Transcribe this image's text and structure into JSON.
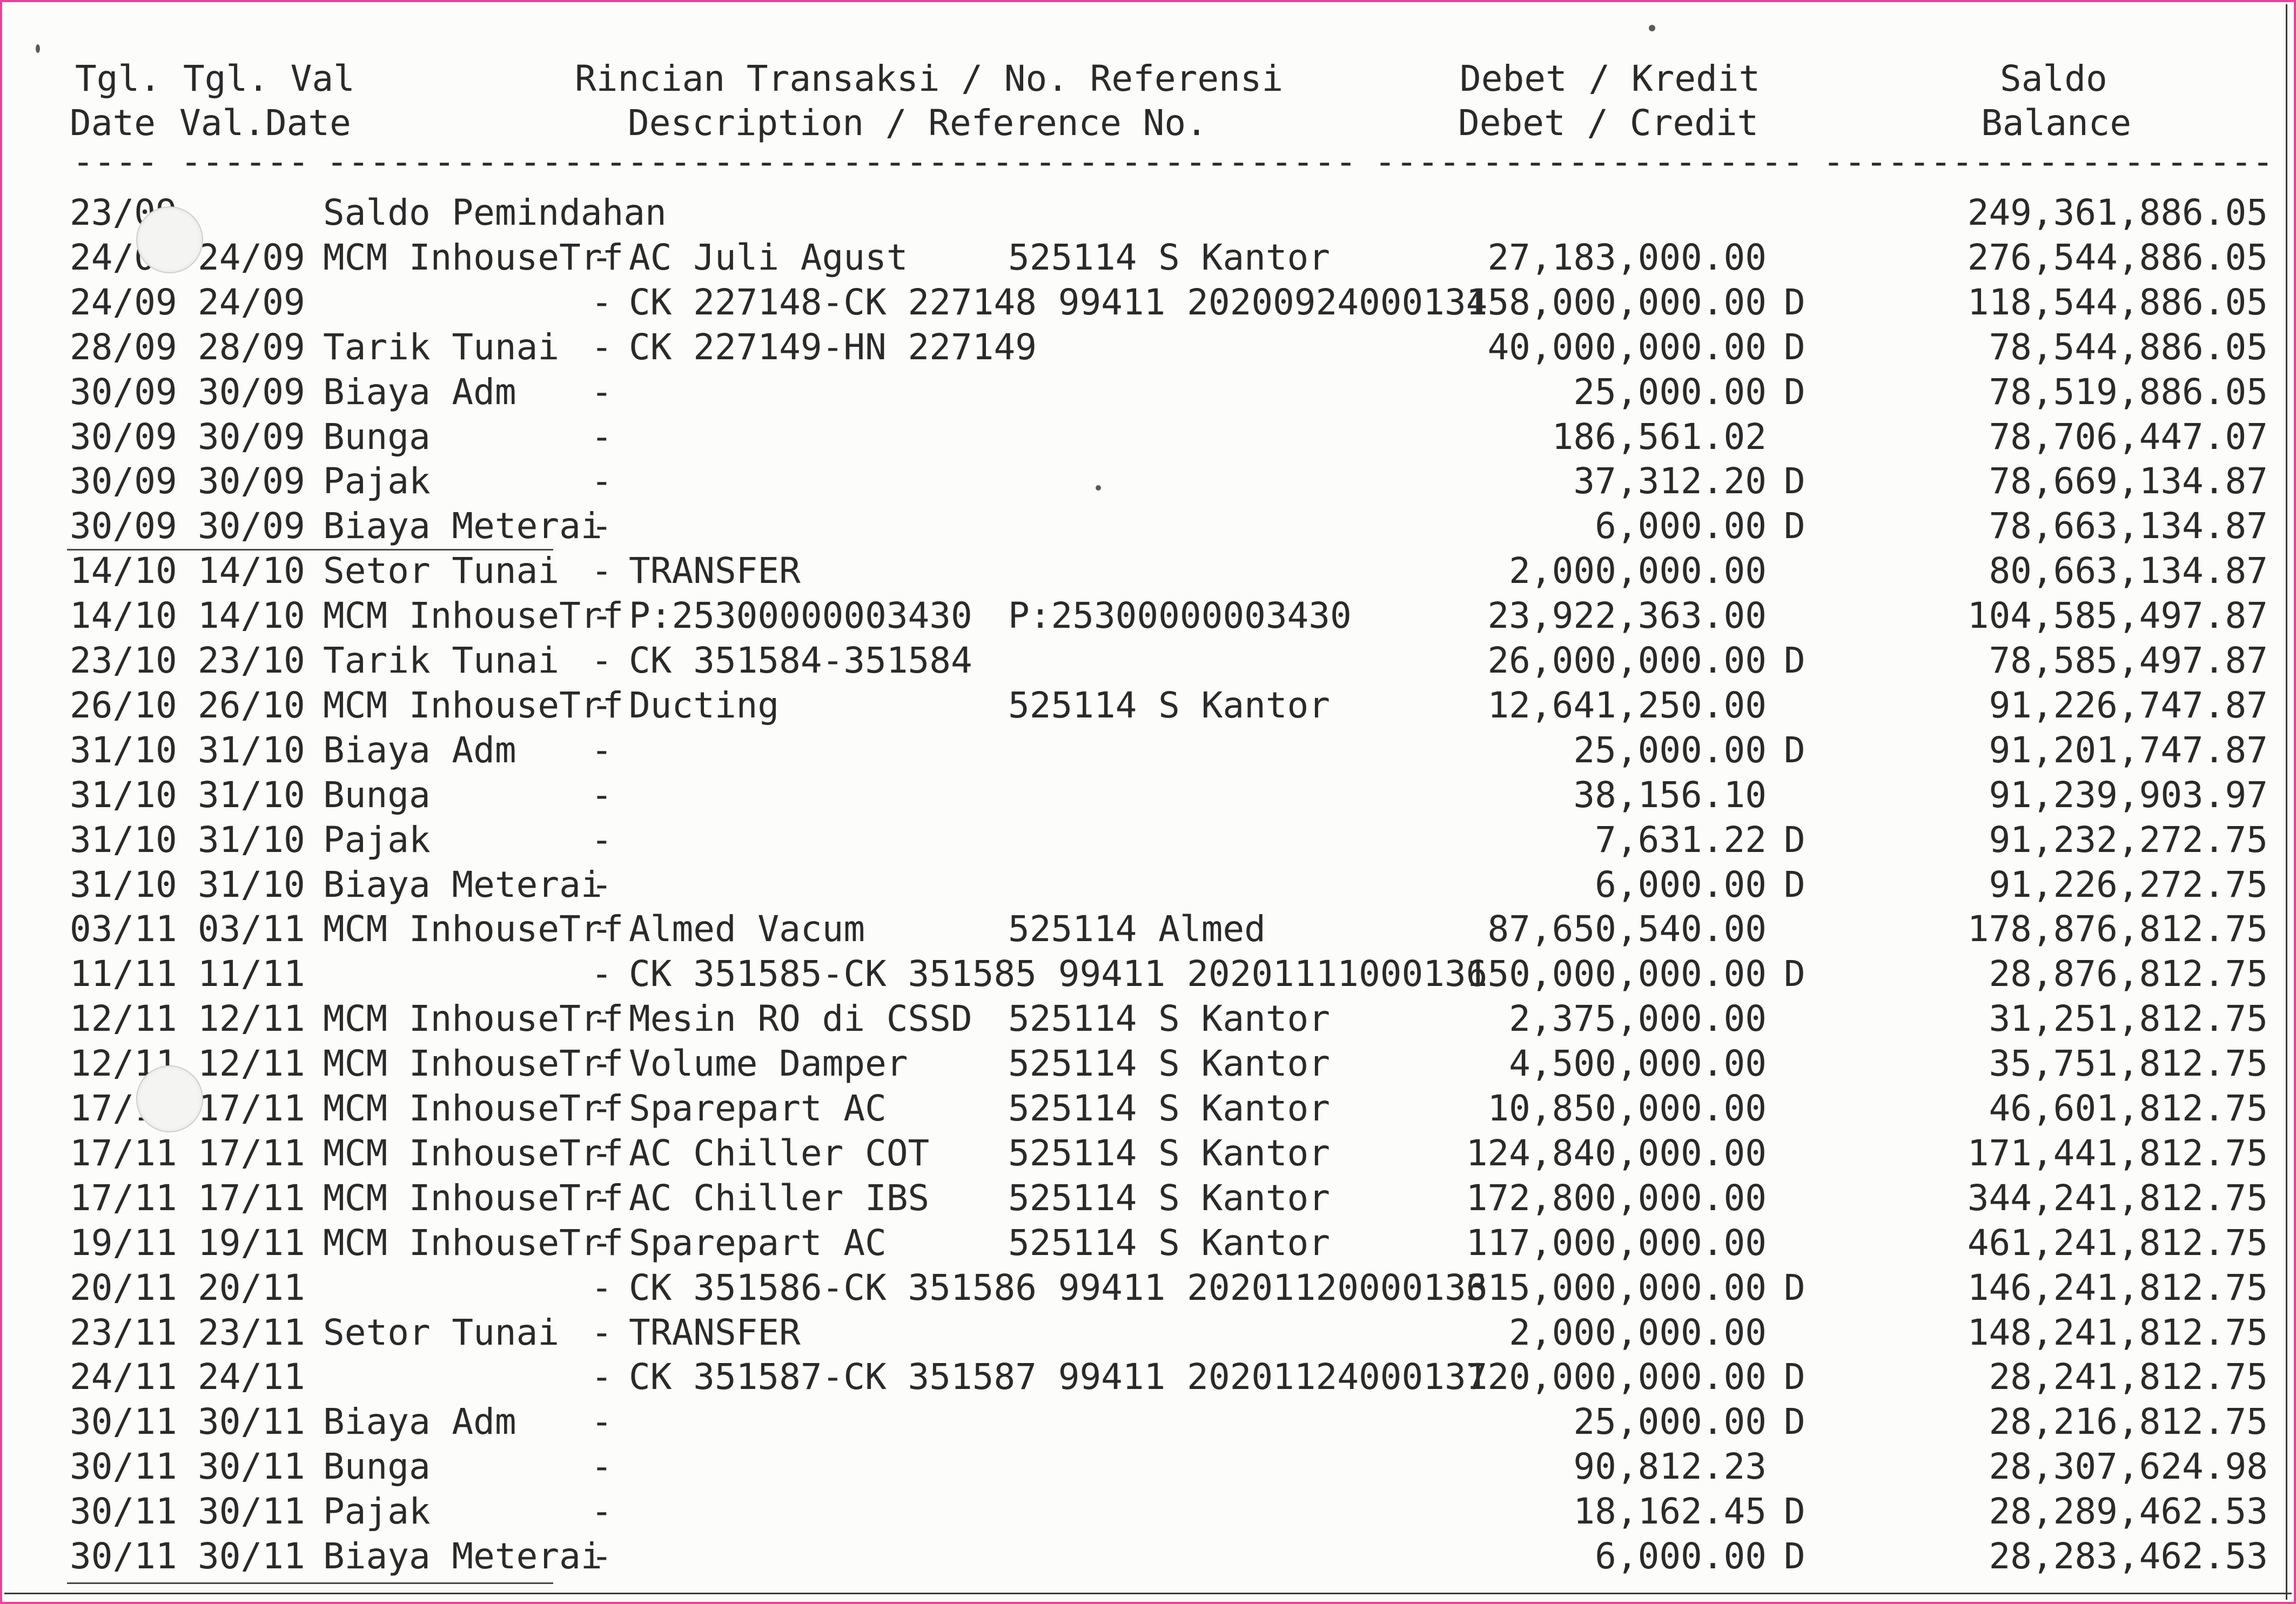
{
  "header": {
    "tgl_id": "Tgl.",
    "tgl_en": "Date",
    "val_id": "Tgl. Val",
    "val_en": "Val.Date",
    "desc_id": "Rincian Transaksi / No. Referensi",
    "desc_en": "Description / Reference No.",
    "amount_id": "Debet / Kredit",
    "amount_en": "Debet / Credit",
    "balance_id": "Saldo",
    "balance_en": "Balance"
  },
  "transactions": [
    {
      "date": "23/09",
      "val": "",
      "type": "Saldo Pemindahan",
      "dash": "",
      "desc": "",
      "ref": "",
      "amount": "",
      "dc": "",
      "balance": "249,361,886.05"
    },
    {
      "date": "24/09",
      "val": "24/09",
      "type": "MCM InhouseTrf",
      "dash": "-",
      "desc": "AC Juli Agust",
      "ref": "525114 S Kantor",
      "amount": "27,183,000.00",
      "dc": "",
      "balance": "276,544,886.05"
    },
    {
      "date": "24/09",
      "val": "24/09",
      "type": "",
      "dash": "-",
      "desc": "CK 227148-CK 227148 99411 20200924000134",
      "ref": "",
      "amount": "158,000,000.00",
      "dc": "D",
      "balance": "118,544,886.05"
    },
    {
      "date": "28/09",
      "val": "28/09",
      "type": "Tarik Tunai",
      "dash": "-",
      "desc": "CK 227149-HN 227149",
      "ref": "",
      "amount": "40,000,000.00",
      "dc": "D",
      "balance": "78,544,886.05"
    },
    {
      "date": "30/09",
      "val": "30/09",
      "type": "Biaya Adm",
      "dash": "-",
      "desc": "",
      "ref": "",
      "amount": "25,000.00",
      "dc": "D",
      "balance": "78,519,886.05"
    },
    {
      "date": "30/09",
      "val": "30/09",
      "type": "Bunga",
      "dash": "-",
      "desc": "",
      "ref": "",
      "amount": "186,561.02",
      "dc": "",
      "balance": "78,706,447.07"
    },
    {
      "date": "30/09",
      "val": "30/09",
      "type": "Pajak",
      "dash": "-",
      "desc": "",
      "ref": "",
      "amount": "37,312.20",
      "dc": "D",
      "balance": "78,669,134.87"
    },
    {
      "date": "30/09",
      "val": "30/09",
      "type": "Biaya Meterai",
      "dash": "-",
      "desc": "",
      "ref": "",
      "amount": "6,000.00",
      "dc": "D",
      "balance": "78,663,134.87"
    },
    {
      "date": "14/10",
      "val": "14/10",
      "type": "Setor Tunai",
      "dash": "-",
      "desc": "TRANSFER",
      "ref": "",
      "amount": "2,000,000.00",
      "dc": "",
      "balance": "80,663,134.87"
    },
    {
      "date": "14/10",
      "val": "14/10",
      "type": "MCM InhouseTrf",
      "dash": "-",
      "desc": "P:25300000003430",
      "ref": "P:25300000003430",
      "amount": "23,922,363.00",
      "dc": "",
      "balance": "104,585,497.87"
    },
    {
      "date": "23/10",
      "val": "23/10",
      "type": "Tarik Tunai",
      "dash": "-",
      "desc": "CK 351584-351584",
      "ref": "",
      "amount": "26,000,000.00",
      "dc": "D",
      "balance": "78,585,497.87"
    },
    {
      "date": "26/10",
      "val": "26/10",
      "type": "MCM InhouseTrf",
      "dash": "-",
      "desc": "Ducting",
      "ref": "525114 S Kantor",
      "amount": "12,641,250.00",
      "dc": "",
      "balance": "91,226,747.87"
    },
    {
      "date": "31/10",
      "val": "31/10",
      "type": "Biaya Adm",
      "dash": "-",
      "desc": "",
      "ref": "",
      "amount": "25,000.00",
      "dc": "D",
      "balance": "91,201,747.87"
    },
    {
      "date": "31/10",
      "val": "31/10",
      "type": "Bunga",
      "dash": "-",
      "desc": "",
      "ref": "",
      "amount": "38,156.10",
      "dc": "",
      "balance": "91,239,903.97"
    },
    {
      "date": "31/10",
      "val": "31/10",
      "type": "Pajak",
      "dash": "-",
      "desc": "",
      "ref": "",
      "amount": "7,631.22",
      "dc": "D",
      "balance": "91,232,272.75"
    },
    {
      "date": "31/10",
      "val": "31/10",
      "type": "Biaya Meterai",
      "dash": "-",
      "desc": "",
      "ref": "",
      "amount": "6,000.00",
      "dc": "D",
      "balance": "91,226,272.75"
    },
    {
      "date": "03/11",
      "val": "03/11",
      "type": "MCM InhouseTrf",
      "dash": "-",
      "desc": "Almed Vacum",
      "ref": "525114 Almed",
      "amount": "87,650,540.00",
      "dc": "",
      "balance": "178,876,812.75"
    },
    {
      "date": "11/11",
      "val": "11/11",
      "type": "",
      "dash": "-",
      "desc": "CK 351585-CK 351585 99411 20201111000136",
      "ref": "",
      "amount": "150,000,000.00",
      "dc": "D",
      "balance": "28,876,812.75"
    },
    {
      "date": "12/11",
      "val": "12/11",
      "type": "MCM InhouseTrf",
      "dash": "-",
      "desc": "Mesin RO di CSSD",
      "ref": "525114 S Kantor",
      "amount": "2,375,000.00",
      "dc": "",
      "balance": "31,251,812.75"
    },
    {
      "date": "12/11",
      "val": "12/11",
      "type": "MCM InhouseTrf",
      "dash": "-",
      "desc": "Volume Damper",
      "ref": "525114 S Kantor",
      "amount": "4,500,000.00",
      "dc": "",
      "balance": "35,751,812.75"
    },
    {
      "date": "17/11",
      "val": "17/11",
      "type": "MCM InhouseTrf",
      "dash": "-",
      "desc": "Sparepart AC",
      "ref": "525114 S Kantor",
      "amount": "10,850,000.00",
      "dc": "",
      "balance": "46,601,812.75"
    },
    {
      "date": "17/11",
      "val": "17/11",
      "type": "MCM InhouseTrf",
      "dash": "-",
      "desc": "AC Chiller COT",
      "ref": "525114 S Kantor",
      "amount": "124,840,000.00",
      "dc": "",
      "balance": "171,441,812.75"
    },
    {
      "date": "17/11",
      "val": "17/11",
      "type": "MCM InhouseTrf",
      "dash": "-",
      "desc": "AC Chiller IBS",
      "ref": "525114 S Kantor",
      "amount": "172,800,000.00",
      "dc": "",
      "balance": "344,241,812.75"
    },
    {
      "date": "19/11",
      "val": "19/11",
      "type": "MCM InhouseTrf",
      "dash": "-",
      "desc": "Sparepart AC",
      "ref": "525114 S Kantor",
      "amount": "117,000,000.00",
      "dc": "",
      "balance": "461,241,812.75"
    },
    {
      "date": "20/11",
      "val": "20/11",
      "type": "",
      "dash": "-",
      "desc": "CK 351586-CK 351586 99411 20201120000136",
      "ref": "",
      "amount": "315,000,000.00",
      "dc": "D",
      "balance": "146,241,812.75"
    },
    {
      "date": "23/11",
      "val": "23/11",
      "type": "Setor Tunai",
      "dash": "-",
      "desc": "TRANSFER",
      "ref": "",
      "amount": "2,000,000.00",
      "dc": "",
      "balance": "148,241,812.75"
    },
    {
      "date": "24/11",
      "val": "24/11",
      "type": "",
      "dash": "-",
      "desc": "CK 351587-CK 351587 99411 20201124000137",
      "ref": "",
      "amount": "120,000,000.00",
      "dc": "D",
      "balance": "28,241,812.75"
    },
    {
      "date": "30/11",
      "val": "30/11",
      "type": "Biaya Adm",
      "dash": "-",
      "desc": "",
      "ref": "",
      "amount": "25,000.00",
      "dc": "D",
      "balance": "28,216,812.75"
    },
    {
      "date": "30/11",
      "val": "30/11",
      "type": "Bunga",
      "dash": "-",
      "desc": "",
      "ref": "",
      "amount": "90,812.23",
      "dc": "",
      "balance": "28,307,624.98"
    },
    {
      "date": "30/11",
      "val": "30/11",
      "type": "Pajak",
      "dash": "-",
      "desc": "",
      "ref": "",
      "amount": "18,162.45",
      "dc": "D",
      "balance": "28,289,462.53"
    },
    {
      "date": "30/11",
      "val": "30/11",
      "type": "Biaya Meterai",
      "dash": "-",
      "desc": "",
      "ref": "",
      "amount": "6,000.00",
      "dc": "D",
      "balance": "28,283,462.53"
    }
  ]
}
